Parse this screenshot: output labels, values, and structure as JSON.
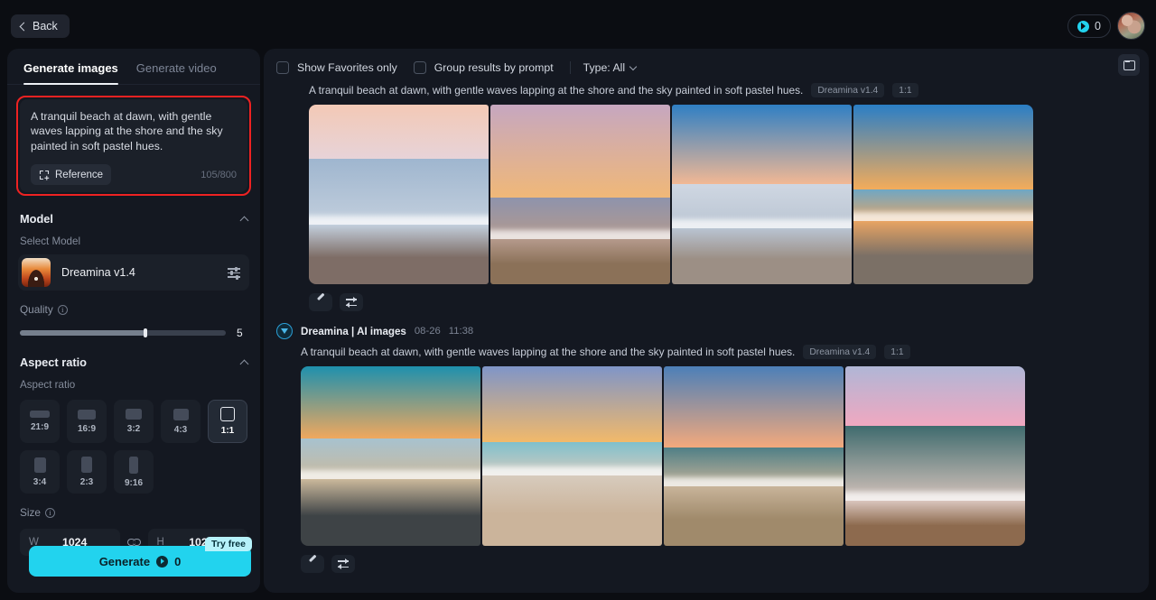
{
  "topbar": {
    "back_label": "Back",
    "credits_value": "0",
    "coin_icon": "coin-icon",
    "avatar_icon": "user-avatar"
  },
  "sidebar": {
    "tabs": [
      {
        "label": "Generate images",
        "active": true
      },
      {
        "label": "Generate video",
        "active": false
      }
    ],
    "prompt": {
      "text": "A tranquil beach at dawn, with gentle waves lapping at the shore and the sky painted in soft pastel hues.",
      "reference_label": "Reference",
      "reference_icon": "add-image-icon",
      "counter": "105/800",
      "highlight_color": "#ee2222"
    },
    "model_section": {
      "title": "Model",
      "sub_label": "Select Model",
      "model_name": "Dreamina v1.4",
      "settings_icon": "sliders-icon",
      "collapse_icon": "chevron-up-icon"
    },
    "quality": {
      "label": "Quality",
      "info_icon": "info-icon",
      "value": "5",
      "percent": 61
    },
    "aspect_section": {
      "title": "Aspect ratio",
      "sub_label": "Aspect ratio",
      "collapse_icon": "chevron-up-icon",
      "options": [
        {
          "label": "21:9",
          "w": 22,
          "h": 8,
          "active": false
        },
        {
          "label": "16:9",
          "w": 20,
          "h": 11,
          "active": false
        },
        {
          "label": "3:2",
          "w": 18,
          "h": 12,
          "active": false
        },
        {
          "label": "4:3",
          "w": 17,
          "h": 13,
          "active": false
        },
        {
          "label": "1:1",
          "w": 16,
          "h": 16,
          "active": true
        },
        {
          "label": "3:4",
          "w": 13,
          "h": 17,
          "active": false
        },
        {
          "label": "2:3",
          "w": 12,
          "h": 18,
          "active": false
        },
        {
          "label": "9:16",
          "w": 10,
          "h": 19,
          "active": false
        }
      ]
    },
    "size": {
      "label": "Size",
      "info_icon": "info-icon",
      "width_key": "W",
      "width_value": "1024",
      "height_key": "H",
      "height_value": "1024",
      "link_icon": "link-icon"
    },
    "generate": {
      "label": "Generate",
      "cost": "0",
      "badge": "Try free",
      "accent_color": "#22d3ee"
    }
  },
  "main": {
    "toolbar": {
      "favorites_label": "Show Favorites only",
      "favorites_checked": false,
      "group_label": "Group results by prompt",
      "group_checked": false,
      "type_label": "Type: All",
      "folder_icon": "folder-icon"
    },
    "groups": [
      {
        "has_header": false,
        "prompt": "A tranquil beach at dawn, with gentle waves lapping at the shore and the sky painted in soft pastel hues.",
        "model_badge": "Dreamina v1.4",
        "ratio_badge": "1:1",
        "edit_icon": "pencil-icon",
        "regenerate_icon": "swap-arrows-icon",
        "images": [
          {
            "name": "pastel-blue-beach",
            "sky_top": "#f3c9b6",
            "sky_bottom": "#e7d3d8",
            "sea_top": "#9fb6cf",
            "sea_bottom": "#c3cfdd",
            "sand": "#7e6d66",
            "horizon": 30,
            "foam": 62
          },
          {
            "name": "purple-sunset-beach",
            "sky_top": "#c6a7c0",
            "sky_bottom": "#f0b878",
            "sea_top": "#8e93ac",
            "sea_bottom": "#b59a8c",
            "sand": "#8b7158",
            "horizon": 52,
            "foam": 70
          },
          {
            "name": "blue-hour-shoreline",
            "sky_top": "#2f7fc4",
            "sky_bottom": "#f2b894",
            "sea_top": "#cfd7e2",
            "sea_bottom": "#b9c4d2",
            "sand": "#9c8f85",
            "horizon": 44,
            "foam": 64
          },
          {
            "name": "golden-sunset-beach",
            "sky_top": "#2a7ec6",
            "sky_bottom": "#f4ac5a",
            "sea_top": "#6fa7c4",
            "sea_bottom": "#e8a463",
            "sand": "#7b7066",
            "horizon": 47,
            "foam": 60
          }
        ]
      },
      {
        "has_header": true,
        "title": "Dreamina | AI images",
        "date": "08-26",
        "time": "11:38",
        "badge_icon": "dreamina-badge-icon",
        "prompt": "A tranquil beach at dawn, with gentle waves lapping at the shore and the sky painted in soft pastel hues.",
        "model_badge": "Dreamina v1.4",
        "ratio_badge": "1:1",
        "edit_icon": "pencil-icon",
        "regenerate_icon": "swap-arrows-icon",
        "images": [
          {
            "name": "teal-dawn-beach",
            "sky_top": "#1e90ae",
            "sky_bottom": "#f0a85e",
            "sea_top": "#a7c2cf",
            "sea_bottom": "#cbb99c",
            "sand": "#3e4346",
            "horizon": 40,
            "foam": 58
          },
          {
            "name": "breaking-wave-beach",
            "sky_top": "#7f95c8",
            "sky_bottom": "#f2b96a",
            "sea_top": "#7fc0cd",
            "sea_bottom": "#d7cbbd",
            "sand": "#cbb49b",
            "horizon": 42,
            "foam": 56
          },
          {
            "name": "mountain-sunset-surf",
            "sky_top": "#4c7fb8",
            "sky_bottom": "#f3a97c",
            "sea_top": "#4f7f86",
            "sea_bottom": "#c8b49a",
            "sand": "#a08a6b",
            "horizon": 45,
            "foam": 62
          },
          {
            "name": "pink-pastel-surf",
            "sky_top": "#b0b6d6",
            "sky_bottom": "#f0a8c0",
            "sea_top": "#3f6b6e",
            "sea_bottom": "#d9c5bd",
            "sand": "#8d6a4e",
            "horizon": 33,
            "foam": 70
          }
        ]
      }
    ]
  }
}
